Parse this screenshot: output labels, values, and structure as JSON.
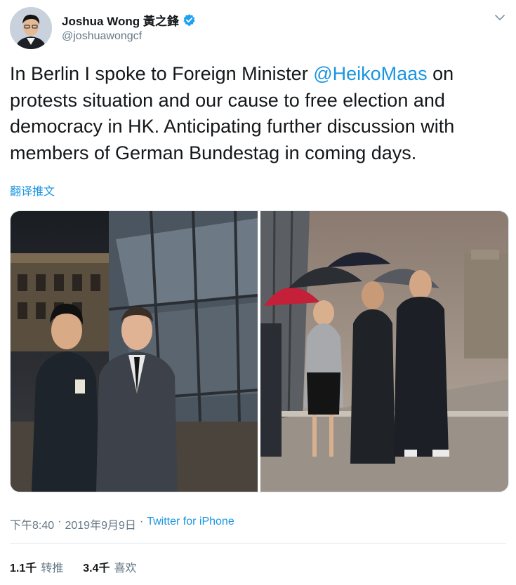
{
  "author": {
    "display_name": "Joshua Wong 黃之鋒",
    "handle": "@joshuawongcf",
    "verified": true
  },
  "tweet": {
    "text_before_mention": "In Berlin I spoke to Foreign Minister ",
    "mention": "@HeikoMaas",
    "text_after_mention": " on protests situation and our cause to free election and democracy in HK. Anticipating further discussion with members of German Bundestag in coming days.",
    "translate_label": "翻译推文"
  },
  "meta": {
    "time": "下午8:40",
    "separator_1": "·",
    "date": "2019年9月9日",
    "separator_2": "·",
    "source": "Twitter for iPhone"
  },
  "stats": {
    "retweets_count": "1.1千",
    "retweets_label": "转推",
    "likes_count": "3.4千",
    "likes_label": "喜欢"
  },
  "colors": {
    "link": "#1b95e0",
    "secondary_text": "#657786",
    "verified_badge": "#1da1f2"
  },
  "icons": {
    "verified": "verified-badge-icon",
    "menu": "chevron-down-icon"
  }
}
